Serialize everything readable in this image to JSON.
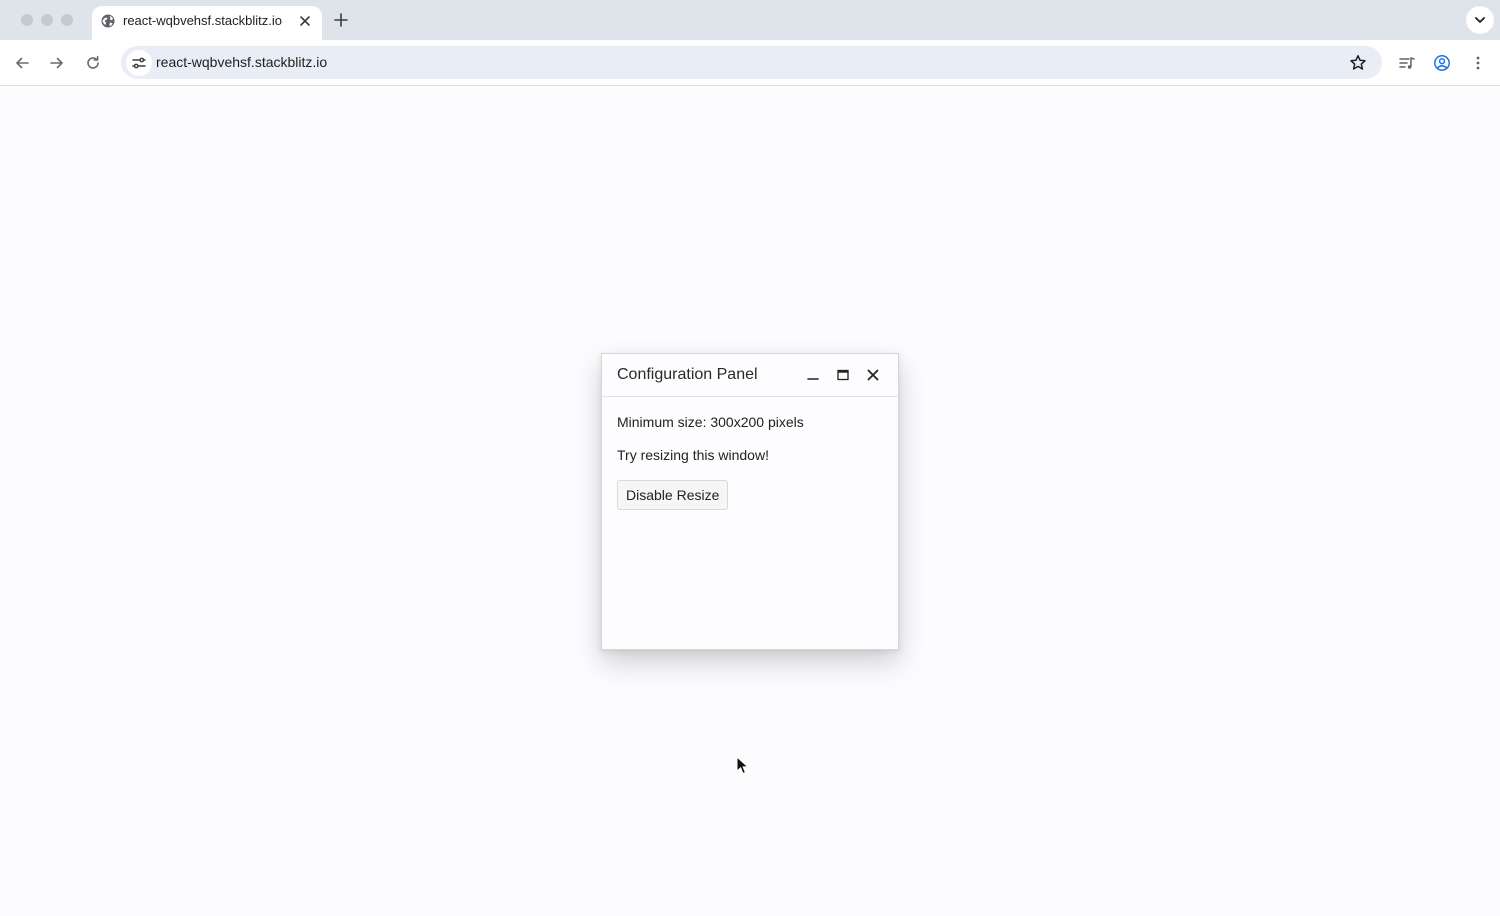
{
  "browser": {
    "tab": {
      "title": "react-wqbvehsf.stackblitz.io",
      "favicon": "globe-icon"
    },
    "address_bar": {
      "url": "react-wqbvehsf.stackblitz.io"
    },
    "icons": [
      "back-arrow-icon",
      "forward-arrow-icon",
      "reload-icon",
      "site-info-icon",
      "star-icon",
      "media-controls-icon",
      "profile-icon",
      "more-vert-icon",
      "tab-search-icon",
      "new-tab-icon",
      "close-icon"
    ]
  },
  "window": {
    "title": "Configuration Panel",
    "controls": [
      "minimize-icon",
      "maximize-icon",
      "close-icon"
    ],
    "body": {
      "min_size_text": "Minimum size: 300x200 pixels",
      "hint_text": "Try resizing this window!",
      "button_label": "Disable Resize"
    }
  },
  "colors": {
    "tabbar_bg": "#dfe3ea",
    "omnibox_bg": "#e9eef6",
    "page_bg": "#fcfbfd",
    "window_border": "#d6d6d6"
  }
}
